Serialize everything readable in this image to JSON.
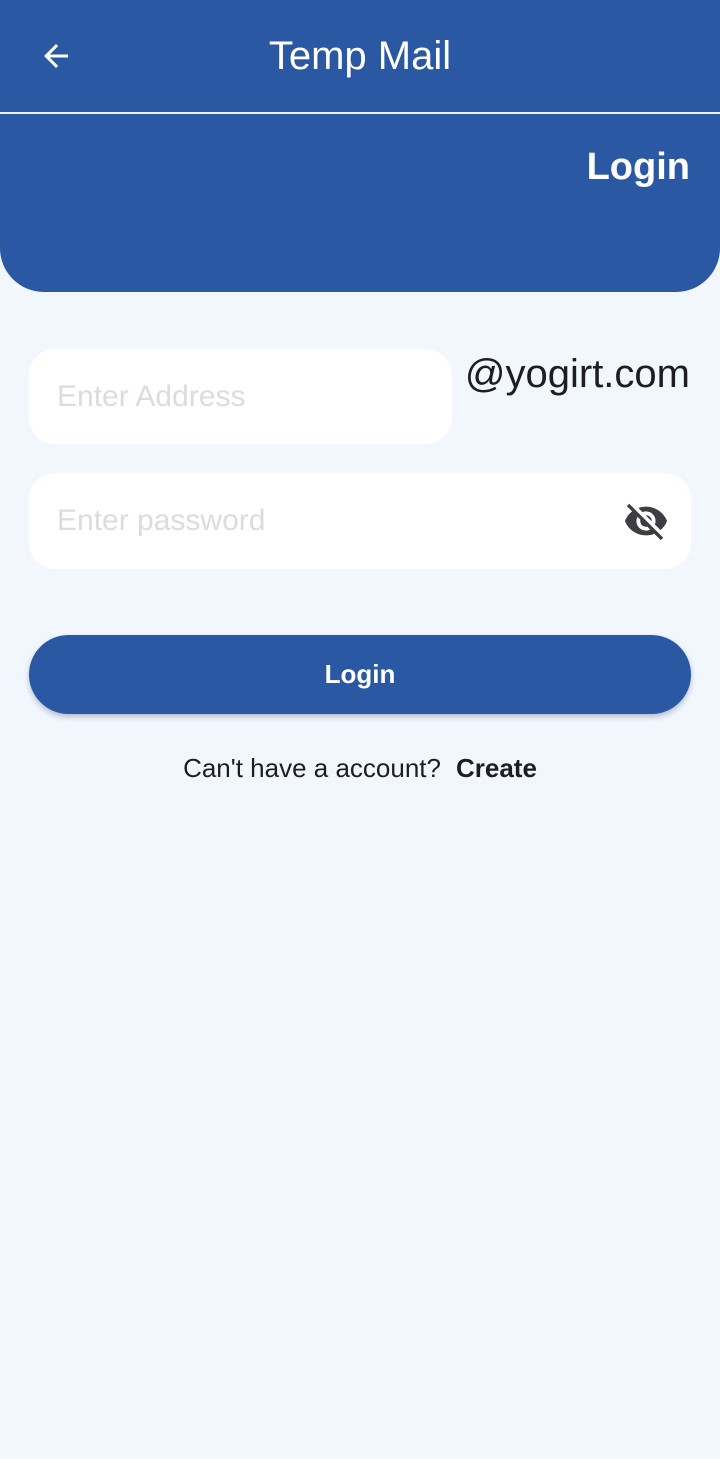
{
  "app_bar": {
    "title": "Temp Mail",
    "back_icon": "arrow-left-icon"
  },
  "header": {
    "title": "Login"
  },
  "form": {
    "address_placeholder": "Enter Address",
    "address_value": "",
    "domain_suffix": "@yogirt.com",
    "password_placeholder": "Enter password",
    "password_value": "",
    "visibility_icon": "eye-off-icon",
    "login_button_label": "Login"
  },
  "signup": {
    "prompt": "Can't have a account?",
    "link_label": "Create"
  },
  "colors": {
    "primary": "#2b58a3",
    "background": "#f2f7fe",
    "field_background": "#ffffff",
    "text": "#1d1d22",
    "placeholder": "#dcdce0"
  }
}
